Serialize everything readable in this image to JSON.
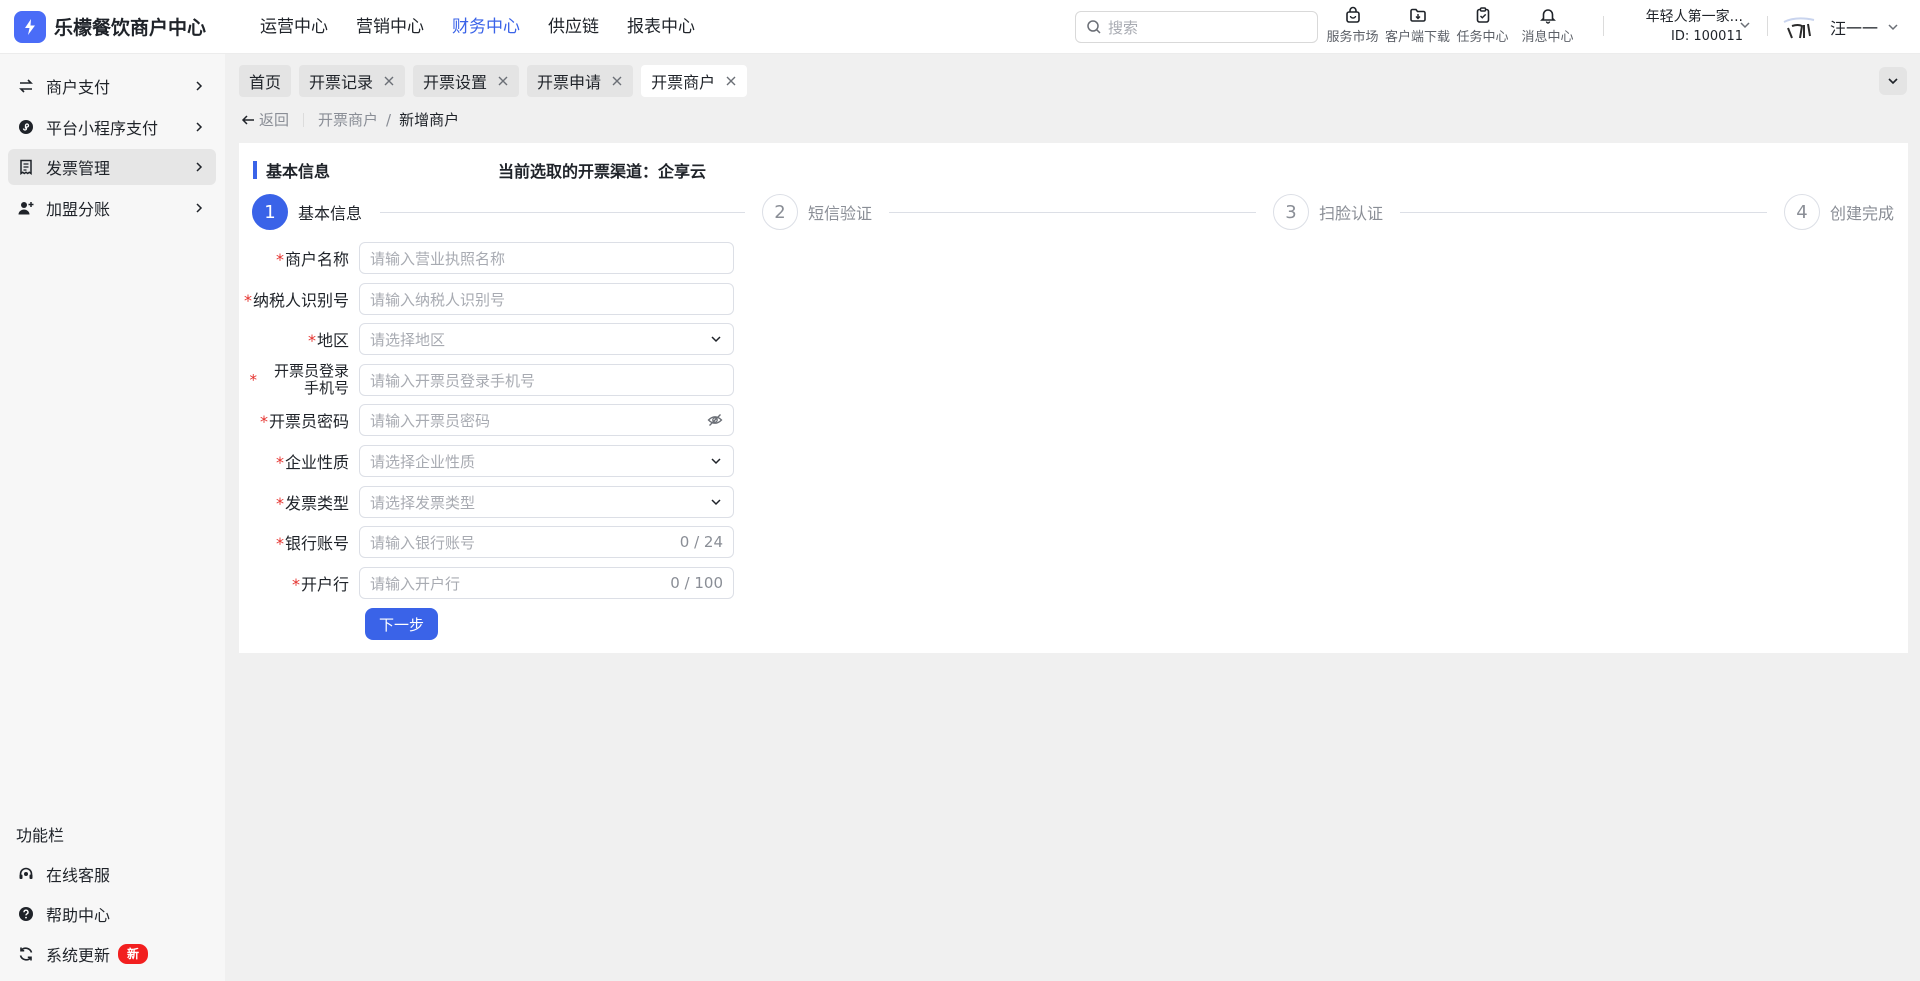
{
  "app": {
    "title": "乐檬餐饮商户中心",
    "brand_color": "#4a6cf7",
    "accent": "#3a63e8"
  },
  "topnav": [
    {
      "label": "运营中心",
      "active": false
    },
    {
      "label": "营销中心",
      "active": false
    },
    {
      "label": "财务中心",
      "active": true
    },
    {
      "label": "供应链",
      "active": false
    },
    {
      "label": "报表中心",
      "active": false
    }
  ],
  "search": {
    "placeholder": "搜索"
  },
  "tools": [
    {
      "label": "服务市场",
      "icon": "shop-bag-icon"
    },
    {
      "label": "客户端下载",
      "icon": "folder-download-icon"
    },
    {
      "label": "任务中心",
      "icon": "clipboard-check-icon"
    },
    {
      "label": "消息中心",
      "icon": "bell-icon"
    }
  ],
  "store": {
    "name": "年轻人第一家...",
    "id": "ID: 100011"
  },
  "user": {
    "name": "汪一一"
  },
  "sidebar": {
    "items": [
      {
        "label": "商户支付",
        "icon": "exchange-icon"
      },
      {
        "label": "平台小程序支付",
        "icon": "mini-program-icon"
      },
      {
        "label": "发票管理",
        "icon": "receipt-icon",
        "active": true
      },
      {
        "label": "加盟分账",
        "icon": "user-add-icon"
      }
    ],
    "func_title": "功能栏",
    "bottom": [
      {
        "label": "在线客服",
        "icon": "headset-icon"
      },
      {
        "label": "帮助中心",
        "icon": "help-icon"
      },
      {
        "label": "系统更新",
        "icon": "refresh-icon",
        "badge": "新"
      }
    ]
  },
  "tabs": [
    {
      "label": "首页",
      "closable": false
    },
    {
      "label": "开票记录",
      "closable": true
    },
    {
      "label": "开票设置",
      "closable": true
    },
    {
      "label": "开票申请",
      "closable": true
    },
    {
      "label": "开票商户",
      "closable": true,
      "active": true
    }
  ],
  "breadcrumb": {
    "back": "返回",
    "parent": "开票商户",
    "separator": "/",
    "current": "新增商户"
  },
  "section": {
    "title": "基本信息",
    "channel": "当前选取的开票渠道：企享云"
  },
  "steps": [
    {
      "num": "1",
      "label": "基本信息",
      "active": true
    },
    {
      "num": "2",
      "label": "短信验证",
      "active": false
    },
    {
      "num": "3",
      "label": "扫脸认证",
      "active": false
    },
    {
      "num": "4",
      "label": "创建完成",
      "active": false
    }
  ],
  "form": {
    "required_mark": "*",
    "fields": [
      {
        "label": "商户名称",
        "placeholder": "请输入营业执照名称"
      },
      {
        "label": "纳税人识别号",
        "placeholder": "请输入纳税人识别号"
      },
      {
        "label": "地区",
        "placeholder": "请选择地区"
      },
      {
        "label": "开票员登录手机号",
        "placeholder": "请输入开票员登录手机号"
      },
      {
        "label": "开票员密码",
        "placeholder": "请输入开票员密码"
      },
      {
        "label": "企业性质",
        "placeholder": "请选择企业性质"
      },
      {
        "label": "发票类型",
        "placeholder": "请选择发票类型"
      },
      {
        "label": "银行账号",
        "placeholder": "请输入银行账号",
        "count": "0 / 24"
      },
      {
        "label": "开户行",
        "placeholder": "请输入开户行",
        "count": "0 / 100"
      }
    ],
    "next_button": "下一步"
  }
}
